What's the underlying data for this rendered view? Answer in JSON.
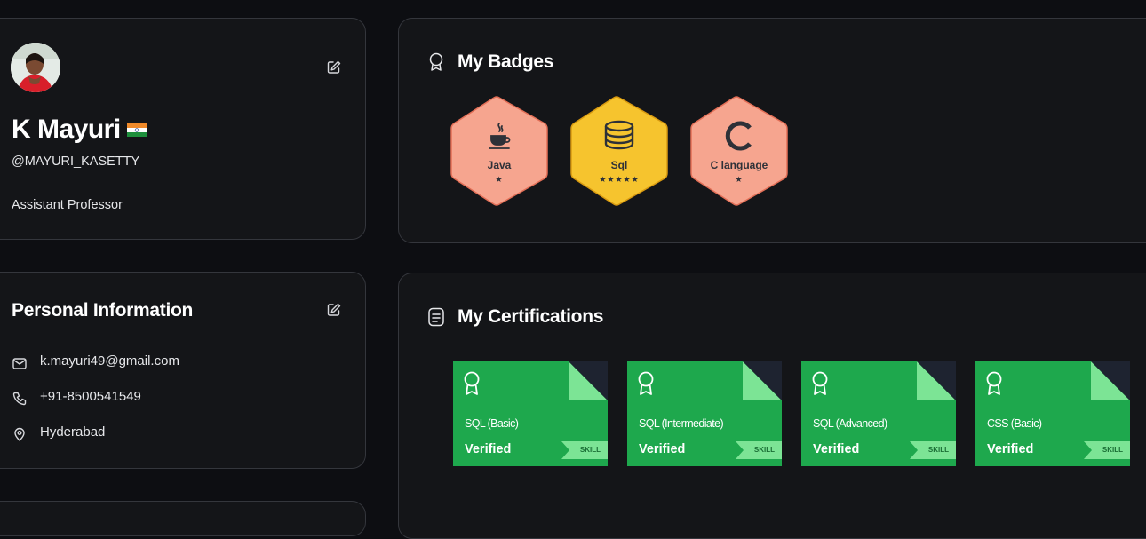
{
  "profile": {
    "name": "K Mayuri",
    "handle": "@MAYURI_KASETTY",
    "role": "Assistant Professor"
  },
  "personal": {
    "title": "Personal Information",
    "email": "k.mayuri49@gmail.com",
    "phone": "+91-8500541549",
    "location": "Hyderabad"
  },
  "badges": {
    "title": "My Badges",
    "items": [
      {
        "label": "Java",
        "stars": "★",
        "color": "#f6a58f",
        "icon": "java-cup-icon"
      },
      {
        "label": "Sql",
        "stars": "★★★★★",
        "color": "#f6c42e",
        "icon": "database-icon"
      },
      {
        "label": "C language",
        "stars": "★",
        "color": "#f6a58f",
        "icon": "c-letter-icon"
      }
    ]
  },
  "certifications": {
    "title": "My Certifications",
    "items": [
      {
        "name": "SQL (Basic)",
        "status": "Verified",
        "tag": "SKILL"
      },
      {
        "name": "SQL (Intermediate)",
        "status": "Verified",
        "tag": "SKILL"
      },
      {
        "name": "SQL (Advanced)",
        "status": "Verified",
        "tag": "SKILL"
      },
      {
        "name": "CSS (Basic)",
        "status": "Verified",
        "tag": "SKILL"
      }
    ]
  },
  "colors": {
    "background": "#0d0e12",
    "card": "#141518",
    "cert_green": "#1ea84d",
    "cert_light_green": "#7ce495",
    "badge_salmon": "#f6a58f",
    "badge_gold": "#f6c42e"
  }
}
